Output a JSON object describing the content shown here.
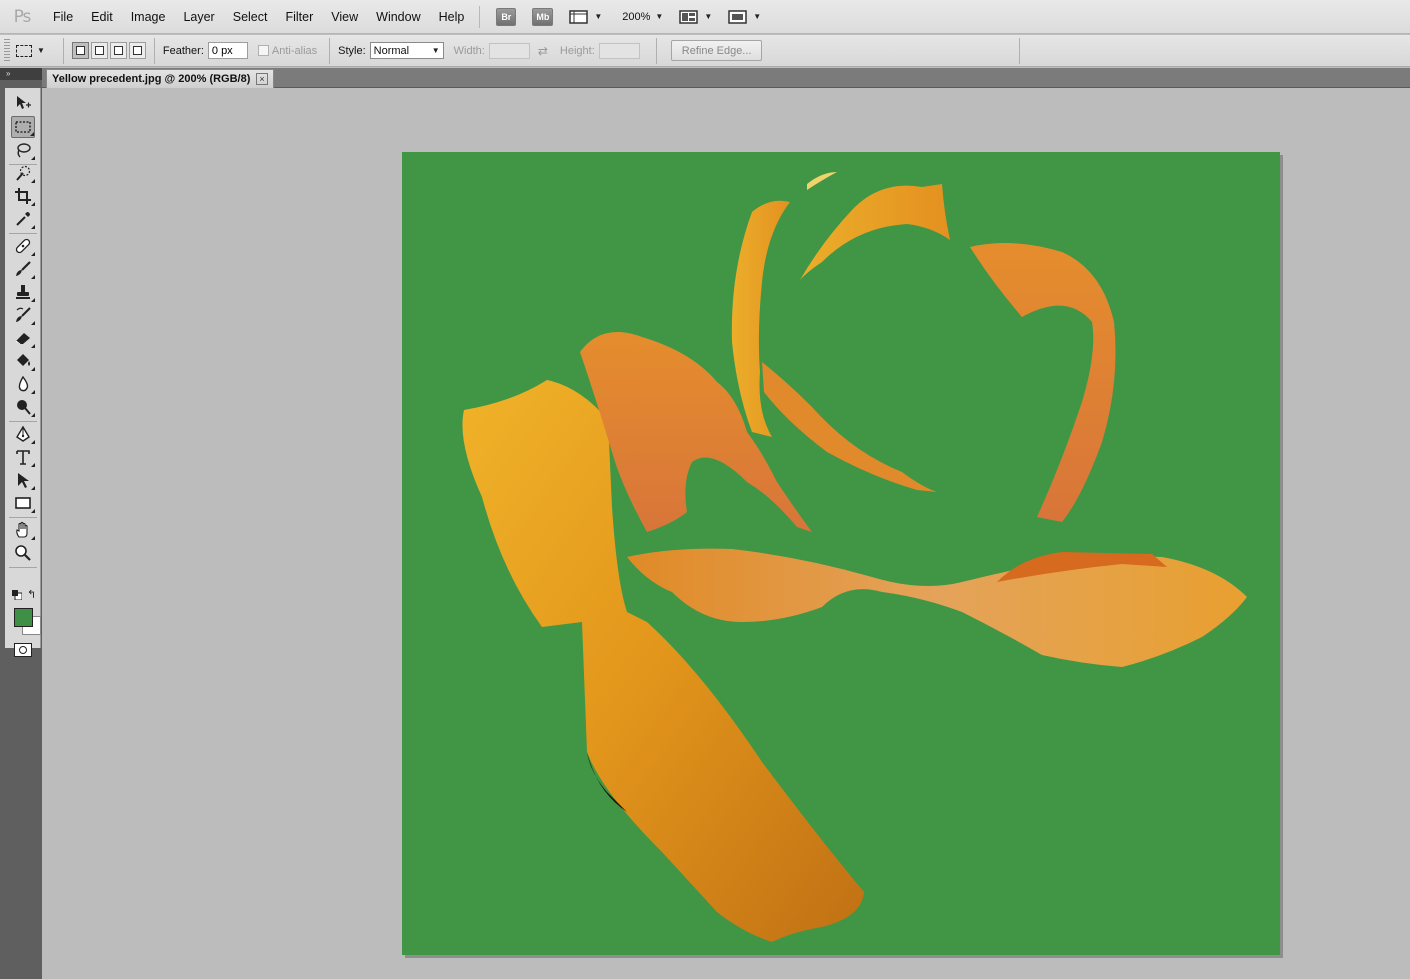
{
  "app": {
    "logo": "Ps"
  },
  "menu": [
    "File",
    "Edit",
    "Image",
    "Layer",
    "Select",
    "Filter",
    "View",
    "Window",
    "Help"
  ],
  "menubar": {
    "bridge_btn": "Br",
    "minibridge_btn": "Mb",
    "zoom_value": "200%"
  },
  "options": {
    "feather_label": "Feather:",
    "feather_value": "0 px",
    "antialias_label": "Anti-alias",
    "style_label": "Style:",
    "style_value": "Normal",
    "width_label": "Width:",
    "height_label": "Height:",
    "refine_edge_label": "Refine Edge..."
  },
  "document": {
    "tab_title": "Yellow precedent.jpg @ 200% (RGB/8)",
    "close_symbol": "×"
  },
  "colors": {
    "canvas_background": "#419645",
    "foreground_color": "#3f8f47",
    "background_color": "#ffffff",
    "petal_primary": "#e79a1a",
    "petal_highlight": "#f2b12a",
    "petal_shadow": "#b5600f"
  }
}
